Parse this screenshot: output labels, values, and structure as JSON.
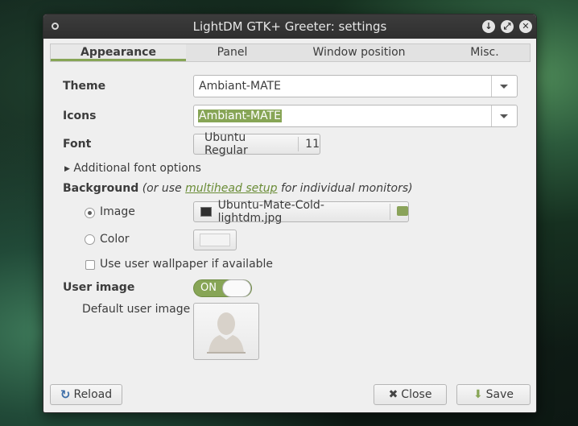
{
  "window": {
    "title": "LightDM GTK+ Greeter: settings"
  },
  "tabs": [
    "Appearance",
    "Panel",
    "Window position",
    "Misc."
  ],
  "theme": {
    "label": "Theme",
    "value": "Ambiant-MATE"
  },
  "icons": {
    "label": "Icons",
    "value": "Ambiant-MATE"
  },
  "font": {
    "label": "Font",
    "name": "Ubuntu Regular",
    "size": "11"
  },
  "additional_fonts": {
    "label": "Additional font options"
  },
  "background": {
    "label": "Background",
    "note_prefix": "(or use ",
    "note_link": "multihead setup",
    "note_suffix": " for individual monitors)",
    "image_option": "Image",
    "image_file": "Ubuntu-Mate-Cold-lightdm.jpg",
    "color_option": "Color",
    "color_value": "#f3f3f3",
    "wallpaper_check": "Use user wallpaper if available"
  },
  "user_image": {
    "label": "User image",
    "switch": "ON",
    "default_label": "Default user image"
  },
  "buttons": {
    "reload": "Reload",
    "close": "Close",
    "save": "Save"
  },
  "colors": {
    "accent": "#87a556",
    "titlebar": "#3c3c3c"
  }
}
